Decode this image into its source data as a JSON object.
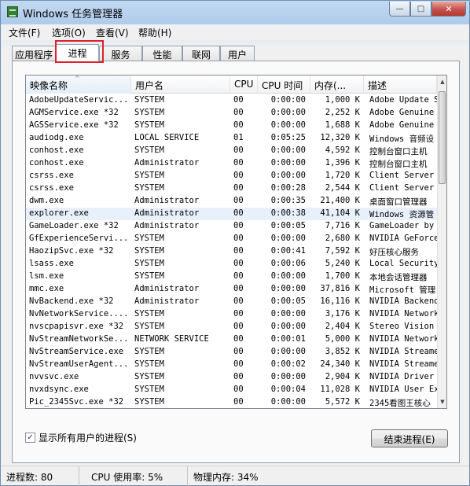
{
  "window": {
    "title": "Windows 任务管理器",
    "caption_min": "—",
    "caption_max": "□",
    "caption_close": "✕"
  },
  "menu": [
    "文件(F)",
    "选项(O)",
    "查看(V)",
    "帮助(H)"
  ],
  "tabs": [
    "应用程序",
    "进程",
    "服务",
    "性能",
    "联网",
    "用户"
  ],
  "active_tab": "进程",
  "columns": [
    "映像名称",
    "用户名",
    "CPU",
    "CPU 时间",
    "内存(...",
    "描述"
  ],
  "processes": [
    [
      "AdobeUpdateServic...",
      "SYSTEM",
      "00",
      "0:00:00",
      "1,000 K",
      "Adobe Update S"
    ],
    [
      "AGMService.exe *32",
      "SYSTEM",
      "00",
      "0:00:00",
      "2,252 K",
      "Adobe Genuine"
    ],
    [
      "AGSService.exe *32",
      "SYSTEM",
      "00",
      "0:00:00",
      "1,688 K",
      "Adobe Genuine"
    ],
    [
      "audiodg.exe",
      "LOCAL SERVICE",
      "01",
      "0:05:25",
      "12,320 K",
      "Windows 音频设"
    ],
    [
      "conhost.exe",
      "SYSTEM",
      "00",
      "0:00:00",
      "4,592 K",
      "控制台窗口主机"
    ],
    [
      "conhost.exe",
      "Administrator",
      "00",
      "0:00:00",
      "1,396 K",
      "控制台窗口主机"
    ],
    [
      "csrss.exe",
      "SYSTEM",
      "00",
      "0:00:00",
      "1,720 K",
      "Client Server"
    ],
    [
      "csrss.exe",
      "SYSTEM",
      "00",
      "0:00:28",
      "2,544 K",
      "Client Server"
    ],
    [
      "dwm.exe",
      "Administrator",
      "00",
      "0:00:35",
      "21,400 K",
      "桌面窗口管理器"
    ],
    [
      "explorer.exe",
      "Administrator",
      "00",
      "0:00:38",
      "41,104 K",
      "Windows 资源管"
    ],
    [
      "GameLoader.exe *32",
      "Administrator",
      "00",
      "0:00:05",
      "7,716 K",
      "GameLoader by"
    ],
    [
      "GfExperienceServi...",
      "SYSTEM",
      "00",
      "0:00:00",
      "2,680 K",
      "NVIDIA GeForce"
    ],
    [
      "HaozipSvc.exe *32",
      "SYSTEM",
      "00",
      "0:00:41",
      "7,592 K",
      "好压核心服务"
    ],
    [
      "lsass.exe",
      "SYSTEM",
      "00",
      "0:00:06",
      "5,240 K",
      "Local Security"
    ],
    [
      "lsm.exe",
      "SYSTEM",
      "00",
      "0:00:00",
      "1,700 K",
      "本地会话管理器"
    ],
    [
      "mmc.exe",
      "Administrator",
      "00",
      "0:00:00",
      "37,816 K",
      "Microsoft 管理"
    ],
    [
      "NvBackend.exe *32",
      "Administrator",
      "00",
      "0:00:05",
      "16,116 K",
      "NVIDIA Backend"
    ],
    [
      "NvNetworkService....",
      "SYSTEM",
      "00",
      "0:00:00",
      "3,176 K",
      "NVIDIA Network"
    ],
    [
      "nvscpapisvr.exe *32",
      "SYSTEM",
      "00",
      "0:00:00",
      "2,404 K",
      "Stereo Vision"
    ],
    [
      "NvStreamNetworkSe...",
      "NETWORK SERVICE",
      "00",
      "0:00:01",
      "5,000 K",
      "NVIDIA Network"
    ],
    [
      "NvStreamService.exe",
      "SYSTEM",
      "00",
      "0:00:00",
      "3,852 K",
      "NVIDIA Streame"
    ],
    [
      "NvStreamUserAgent....",
      "SYSTEM",
      "00",
      "0:00:02",
      "24,340 K",
      "NVIDIA Streame"
    ],
    [
      "nvvsvc.exe",
      "SYSTEM",
      "00",
      "0:00:00",
      "2,904 K",
      "NVIDIA Driver"
    ],
    [
      "nvxdsync.exe",
      "SYSTEM",
      "00",
      "0:00:04",
      "11,028 K",
      "NVIDIA User Ex"
    ],
    [
      "Pic_2345Svc.exe *32",
      "SYSTEM",
      "00",
      "0:00:00",
      "5,572 K",
      "2345看图王核心"
    ]
  ],
  "selected_row_index": 9,
  "show_all_users": {
    "label": "显示所有用户的进程(S)",
    "checked": true,
    "mark": "✓"
  },
  "end_process_label": "结束进程(E)",
  "status": {
    "processes": "进程数: 80",
    "cpu": "CPU 使用率: 5%",
    "memory": "物理内存: 34%"
  },
  "scroll": {
    "up": "▲",
    "down": "▼"
  },
  "sort_indicator": "^"
}
